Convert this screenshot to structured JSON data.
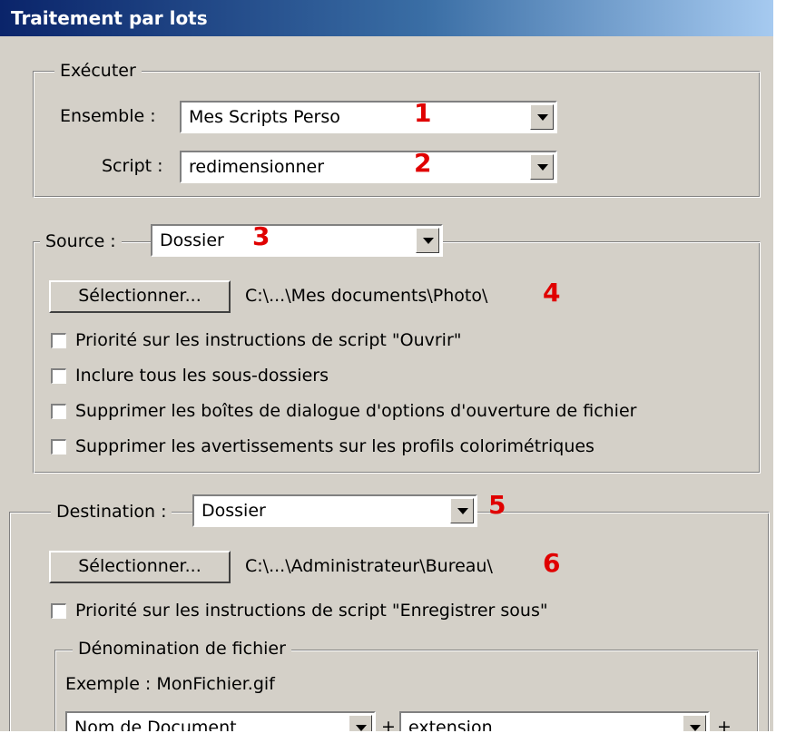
{
  "window": {
    "title": "Traitement par lots"
  },
  "executer": {
    "legend": "Exécuter",
    "ensemble_label": "Ensemble :",
    "ensemble_value": "Mes Scripts Perso",
    "script_label": "Script :",
    "script_value": "redimensionner"
  },
  "source": {
    "legend": "Source :",
    "value": "Dossier",
    "select_button": "Sélectionner...",
    "path": "C:\\...\\Mes documents\\Photo\\",
    "options": [
      "Priorité sur les instructions de script \"Ouvrir\"",
      "Inclure tous les sous-dossiers",
      "Supprimer les boîtes de dialogue d'options d'ouverture de fichier",
      "Supprimer les avertissements sur les profils colorimétriques"
    ]
  },
  "destination": {
    "legend": "Destination :",
    "value": "Dossier",
    "select_button": "Sélectionner...",
    "path": "C:\\...\\Administrateur\\Bureau\\",
    "override_option": "Priorité sur les instructions de script \"Enregistrer sous\"",
    "naming": {
      "legend": "Dénomination de fichier",
      "example": "Exemple : MonFichier.gif",
      "field1": "Nom de Document",
      "plus1": "+",
      "field2": "extension",
      "plus2": "+"
    }
  },
  "annotations": [
    "1",
    "2",
    "3",
    "4",
    "5",
    "6"
  ],
  "colors": {
    "annotation": "#e00000",
    "dialog_bg": "#d4d0c8",
    "title_bar": "#0a246a"
  }
}
